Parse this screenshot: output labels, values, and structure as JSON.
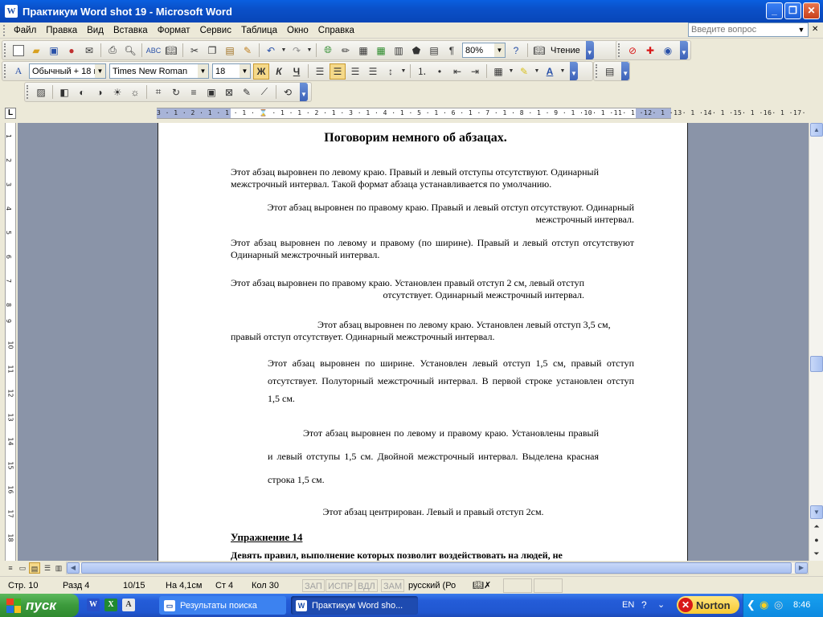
{
  "window": {
    "title": "Практикум Word shot 19 - Microsoft Word",
    "app_icon": "W"
  },
  "menu": {
    "items": [
      "Файл",
      "Правка",
      "Вид",
      "Вставка",
      "Формат",
      "Сервис",
      "Таблица",
      "Окно",
      "Справка"
    ],
    "help_placeholder": "Введите вопрос"
  },
  "toolbar_standard": {
    "zoom": "80%",
    "reading_label": "Чтение",
    "paragraph_mark": "¶"
  },
  "toolbar_format": {
    "style": "Обычный + 18 г",
    "font": "Times New Roman",
    "size": "18",
    "bold": "Ж",
    "italic": "К",
    "underline": "Ч"
  },
  "ruler": {
    "numbers": "3 · 1 · 2 · 1 · 1 · 1 · ⌛ · 1 · 1 · 2 · 1 · 3 · 1 · 4 · 1 · 5 · 1 · 6 · 1 · 7 · 1 · 8 · 1 · 9 · 1 ·10· 1 ·11· 1 ·12· 1 ·13· 1 ·14· 1 ·15· 1 ·16· 1 ·17·"
  },
  "document": {
    "title": "Поговорим немного об абзацах.",
    "p1": "Этот абзац выровнен по левому краю. Правый и левый отступы отсутствуют. Одинарный межстрочный интервал. Такой формат абзаца устанавливается по умолчанию.",
    "p2": "Этот абзац выровнен по правому краю. Правый и левый отступ отсутствуют. Одинарный межстрочный интервал.",
    "p3": "Этот абзац выровнен по левому и правому (по ширине). Правый и левый отступ отсутствуют Одинарный межстрочный интервал.",
    "p4": "Этот абзац выровнен по правому краю. Установлен правый отступ 2 см, левый отступ отсутствует. Одинарный межстрочный интервал.",
    "p5": "Этот абзац выровнен по левому краю. Установлен левый отступ 3,5 см, правый отступ отсутствует. Одинарный межстрочный интервал.",
    "p6": "Этот абзац выровнен по ширине. Установлен левый отступ 1,5 см, правый отступ отсутствует. Полуторный межстрочный интервал. В первой строке установлен отступ 1,5 см.",
    "p7": "Этот абзац выровнен по левому и правому краю. Установлены правый и левый отступы 1,5 см. Двойной межстрочный интервал. Выделена красная строка 1,5 см.",
    "p8": "Этот абзац центрирован. Левый и правый отступ 2см.",
    "exercise": "Упражнение 14",
    "rules": "Девять правил, выполнение которых позволит воздействовать на людей, не"
  },
  "status": {
    "page": "Стр.  10",
    "section": "Разд  4",
    "pages": "10/15",
    "at": "На  4,1см",
    "line": "Ст  4",
    "col": "Кол  30",
    "rec": "ЗАП",
    "trk": "ИСПР",
    "ext": "ВДЛ",
    "ovr": "ЗАМ",
    "lang": "русский (Ро"
  },
  "taskbar": {
    "start": "пуск",
    "task1": "Результаты поиска",
    "task2": "Практикум Word sho...",
    "lang": "EN",
    "norton": "Norton",
    "time": "8:46"
  },
  "colors": {
    "titlebar": "#0a50c8",
    "doc_bg": "#8a94a8",
    "taskbar": "#245cd8",
    "start": "#3c9a3c"
  }
}
